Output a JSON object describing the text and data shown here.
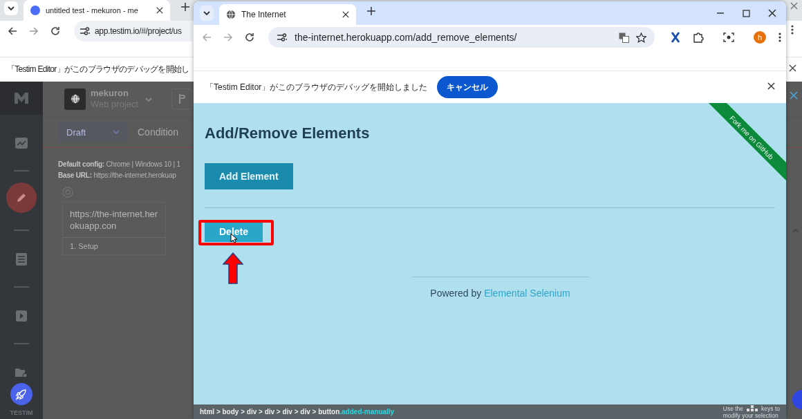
{
  "background_window": {
    "tab": {
      "title": "untitled test - mekuron - me"
    },
    "url": "app.testim.io/#/project/us",
    "infobar": {
      "message": "「Testim Editor」がこのブラウザのデバッグを開始し"
    }
  },
  "testim": {
    "sidebar": [
      {
        "kind": "dashboard",
        "selected": false
      },
      {
        "kind": "editor",
        "selected": true
      },
      {
        "kind": "list",
        "selected": false
      },
      {
        "kind": "runs",
        "selected": false
      },
      {
        "kind": "settings",
        "selected": false
      }
    ],
    "brand": "TESTIM",
    "project": {
      "name": "mekuron",
      "type": "Web project"
    },
    "status": "Draft",
    "tab": "Condition",
    "config": [
      {
        "label": "Default config:",
        "value": "Chrome | Windows 10 | 1"
      },
      {
        "label": "Base URL:",
        "value": "https://the-internet.herokuap"
      }
    ],
    "step_card": {
      "url": "https://the-internet.herokuapp.con",
      "step": "1. Setup"
    }
  },
  "front_window": {
    "tab": {
      "title": "The Internet"
    },
    "url": "the-internet.herokuapp.com/add_remove_elements/",
    "profile": "h",
    "infobar": {
      "message": "「Testim Editor」がこのブラウザのデバッグを開始しました",
      "button": "キャンセル"
    },
    "page": {
      "heading": "Add/Remove Elements",
      "add_button": "Add Element",
      "elements": [
        {
          "label": "Delete",
          "highlighted": true
        }
      ],
      "footer": {
        "prefix": "Powered by",
        "link": "Elemental Selenium"
      },
      "ribbon": "Fork me on GitHub"
    },
    "status_bar": {
      "path": "html > body > div > div > div > div > button",
      "selector_class": ".added-manually",
      "hint": [
        "Use the",
        "keys to",
        "modify your selection"
      ]
    }
  }
}
